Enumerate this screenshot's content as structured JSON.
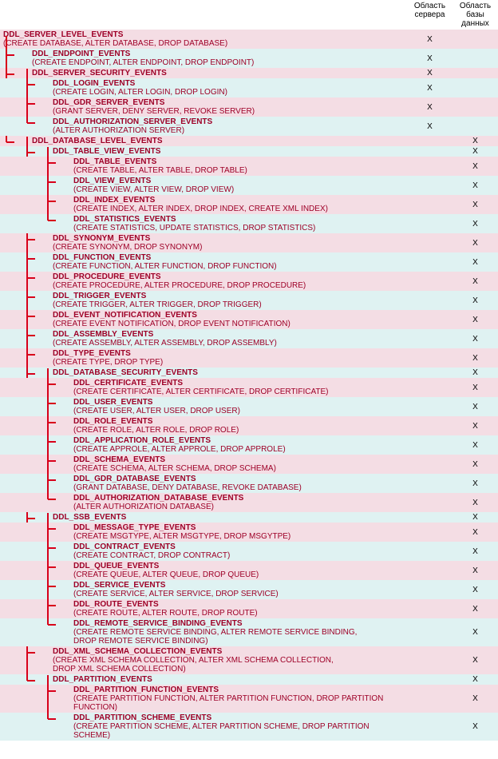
{
  "headers": {
    "server": "Область\nсервера",
    "database": "Область\nбазы данных"
  },
  "rows": [
    {
      "id": "server",
      "indent": 0,
      "sx": "X",
      "dx": "",
      "stripe": "pink",
      "title": "DDL_SERVER_LEVEL_EVENTS",
      "detail": "(CREATE DATABASE, ALTER DATABASE, DROP DATABASE)"
    },
    {
      "id": "endpoint",
      "indent": 1,
      "sx": "X",
      "dx": "",
      "stripe": "blue",
      "title": "DDL_ENDPOINT_EVENTS",
      "detail": "(CREATE ENDPOINT, ALTER ENDPOINT, DROP ENDPOINT)"
    },
    {
      "id": "server-security",
      "indent": 1,
      "sx": "X",
      "dx": "",
      "stripe": "pink",
      "title": "DDL_SERVER_SECURITY_EVENTS",
      "detail": ""
    },
    {
      "id": "login",
      "indent": 2,
      "sx": "X",
      "dx": "",
      "stripe": "blue",
      "title": "DDL_LOGIN_EVENTS",
      "detail": "(CREATE LOGIN, ALTER LOGIN, DROP LOGIN)"
    },
    {
      "id": "gdr-server",
      "indent": 2,
      "sx": "X",
      "dx": "",
      "stripe": "pink",
      "title": "DDL_GDR_SERVER_EVENTS",
      "detail": "(GRANT SERVER, DENY SERVER, REVOKE SERVER)"
    },
    {
      "id": "auth-server",
      "indent": 2,
      "sx": "X",
      "dx": "",
      "stripe": "blue",
      "title": "DDL_AUTHORIZATION_SERVER_EVENTS",
      "detail": "(ALTER AUTHORIZATION SERVER)"
    },
    {
      "id": "database",
      "indent": 1,
      "sx": "",
      "dx": "X",
      "stripe": "pink",
      "title": "DDL_DATABASE_LEVEL_EVENTS",
      "detail": ""
    },
    {
      "id": "table-view",
      "indent": 2,
      "sx": "",
      "dx": "X",
      "stripe": "blue",
      "title": "DDL_TABLE_VIEW_EVENTS",
      "detail": ""
    },
    {
      "id": "table",
      "indent": 3,
      "sx": "",
      "dx": "X",
      "stripe": "pink",
      "title": "DDL_TABLE_EVENTS",
      "detail": "(CREATE TABLE, ALTER TABLE, DROP TABLE)"
    },
    {
      "id": "view",
      "indent": 3,
      "sx": "",
      "dx": "X",
      "stripe": "blue",
      "title": "DDL_VIEW_EVENTS",
      "detail": "(CREATE VIEW, ALTER VIEW, DROP VIEW)"
    },
    {
      "id": "index",
      "indent": 3,
      "sx": "",
      "dx": "X",
      "stripe": "pink",
      "title": "DDL_INDEX_EVENTS",
      "detail": "(CREATE INDEX, ALTER INDEX, DROP INDEX, CREATE XML INDEX)"
    },
    {
      "id": "statistics",
      "indent": 3,
      "sx": "",
      "dx": "X",
      "stripe": "blue",
      "title": "DDL_STATISTICS_EVENTS",
      "detail": "(CREATE STATISTICS, UPDATE STATISTICS, DROP STATISTICS)"
    },
    {
      "id": "synonym",
      "indent": 2,
      "sx": "",
      "dx": "X",
      "stripe": "pink",
      "title": "DDL_SYNONYM_EVENTS",
      "detail": "(CREATE SYNONYM, DROP SYNONYM)"
    },
    {
      "id": "function",
      "indent": 2,
      "sx": "",
      "dx": "X",
      "stripe": "blue",
      "title": "DDL_FUNCTION_EVENTS",
      "detail": "(CREATE FUNCTION, ALTER FUNCTION, DROP FUNCTION)"
    },
    {
      "id": "procedure",
      "indent": 2,
      "sx": "",
      "dx": "X",
      "stripe": "pink",
      "title": "DDL_PROCEDURE_EVENTS",
      "detail": "(CREATE PROCEDURE, ALTER PROCEDURE, DROP PROCEDURE)"
    },
    {
      "id": "trigger",
      "indent": 2,
      "sx": "",
      "dx": "X",
      "stripe": "blue",
      "title": "DDL_TRIGGER_EVENTS",
      "detail": "(CREATE TRIGGER, ALTER TRIGGER, DROP TRIGGER)"
    },
    {
      "id": "event-notification",
      "indent": 2,
      "sx": "",
      "dx": "X",
      "stripe": "pink",
      "title": "DDL_EVENT_NOTIFICATION_EVENTS",
      "detail": "(CREATE EVENT NOTIFICATION, DROP EVENT NOTIFICATION)"
    },
    {
      "id": "assembly",
      "indent": 2,
      "sx": "",
      "dx": "X",
      "stripe": "blue",
      "title": "DDL_ASSEMBLY_EVENTS",
      "detail": "(CREATE ASSEMBLY, ALTER ASSEMBLY, DROP ASSEMBLY)"
    },
    {
      "id": "type",
      "indent": 2,
      "sx": "",
      "dx": "X",
      "stripe": "pink",
      "title": "DDL_TYPE_EVENTS",
      "detail": "(CREATE TYPE, DROP TYPE)"
    },
    {
      "id": "db-security",
      "indent": 2,
      "sx": "",
      "dx": "X",
      "stripe": "blue",
      "title": "DDL_DATABASE_SECURITY_EVENTS",
      "detail": ""
    },
    {
      "id": "certificate",
      "indent": 3,
      "sx": "",
      "dx": "X",
      "stripe": "pink",
      "title": "DDL_CERTIFICATE_EVENTS",
      "detail": "(CREATE CERTIFICATE, ALTER CERTIFICATE, DROP CERTIFICATE)"
    },
    {
      "id": "user",
      "indent": 3,
      "sx": "",
      "dx": "X",
      "stripe": "blue",
      "title": "DDL_USER_EVENTS",
      "detail": "(CREATE USER, ALTER USER, DROP USER)"
    },
    {
      "id": "role",
      "indent": 3,
      "sx": "",
      "dx": "X",
      "stripe": "pink",
      "title": "DDL_ROLE_EVENTS",
      "detail": "(CREATE ROLE, ALTER ROLE, DROP ROLE)"
    },
    {
      "id": "approle",
      "indent": 3,
      "sx": "",
      "dx": "X",
      "stripe": "blue",
      "title": "DDL_APPLICATION_ROLE_EVENTS",
      "detail": "(CREATE APPROLE, ALTER APPROLE, DROP APPROLE)"
    },
    {
      "id": "schema",
      "indent": 3,
      "sx": "",
      "dx": "X",
      "stripe": "pink",
      "title": "DDL_SCHEMA_EVENTS",
      "detail": "(CREATE SCHEMA, ALTER SCHEMA, DROP SCHEMA)"
    },
    {
      "id": "gdr-db",
      "indent": 3,
      "sx": "",
      "dx": "X",
      "stripe": "blue",
      "title": "DDL_GDR_DATABASE_EVENTS",
      "detail": "(GRANT DATABASE, DENY DATABASE, REVOKE DATABASE)"
    },
    {
      "id": "auth-db",
      "indent": 3,
      "sx": "",
      "dx": "X",
      "stripe": "pink",
      "title": "DDL_AUTHORIZATION_DATABASE_EVENTS",
      "detail": "(ALTER AUTHORIZATION DATABASE)"
    },
    {
      "id": "ssb",
      "indent": 2,
      "sx": "",
      "dx": "X",
      "stripe": "blue",
      "title": "DDL_SSB_EVENTS",
      "detail": ""
    },
    {
      "id": "msgtype",
      "indent": 3,
      "sx": "",
      "dx": "X",
      "stripe": "pink",
      "title": "DDL_MESSAGE_TYPE_EVENTS",
      "detail": "(CREATE MSGTYPE, ALTER MSGTYPE, DROP MSGYTPE)"
    },
    {
      "id": "contract",
      "indent": 3,
      "sx": "",
      "dx": "X",
      "stripe": "blue",
      "title": "DDL_CONTRACT_EVENTS",
      "detail": "(CREATE CONTRACT, DROP CONTRACT)"
    },
    {
      "id": "queue",
      "indent": 3,
      "sx": "",
      "dx": "X",
      "stripe": "pink",
      "title": "DDL_QUEUE_EVENTS",
      "detail": "(CREATE QUEUE, ALTER QUEUE, DROP QUEUE)"
    },
    {
      "id": "service",
      "indent": 3,
      "sx": "",
      "dx": "X",
      "stripe": "blue",
      "title": "DDL_SERVICE_EVENTS",
      "detail": "(CREATE SERVICE, ALTER SERVICE, DROP SERVICE)"
    },
    {
      "id": "route",
      "indent": 3,
      "sx": "",
      "dx": "X",
      "stripe": "pink",
      "title": "DDL_ROUTE_EVENTS",
      "detail": "(CREATE ROUTE, ALTER ROUTE, DROP ROUTE)"
    },
    {
      "id": "rsb",
      "indent": 3,
      "sx": "",
      "dx": "X",
      "stripe": "blue",
      "title": "DDL_REMOTE_SERVICE_BINDING_EVENTS",
      "detail": "(CREATE REMOTE SERVICE BINDING, ALTER REMOTE SERVICE BINDING,\n DROP REMOTE SERVICE BINDING)"
    },
    {
      "id": "xml-schema",
      "indent": 2,
      "sx": "",
      "dx": "X",
      "stripe": "pink",
      "title": "DDL_XML_SCHEMA_COLLECTION_EVENTS",
      "detail": "(CREATE XML SCHEMA COLLECTION, ALTER XML SCHEMA COLLECTION,\n DROP XML SCHEMA COLLECTION)"
    },
    {
      "id": "partition",
      "indent": 2,
      "sx": "",
      "dx": "X",
      "stripe": "blue",
      "title": "DDL_PARTITION_EVENTS",
      "detail": ""
    },
    {
      "id": "partition-func",
      "indent": 3,
      "sx": "",
      "dx": "X",
      "stripe": "pink",
      "title": "DDL_PARTITION_FUNCTION_EVENTS",
      "detail": "(CREATE PARTITION FUNCTION, ALTER PARTITION FUNCTION, DROP PARTITION FUNCTION)"
    },
    {
      "id": "partition-scheme",
      "indent": 3,
      "sx": "",
      "dx": "X",
      "stripe": "blue",
      "title": "DDL_PARTITION_SCHEME_EVENTS",
      "detail": "(CREATE PARTITION SCHEME, ALTER PARTITION SCHEME, DROP PARTITION SCHEME)"
    }
  ]
}
